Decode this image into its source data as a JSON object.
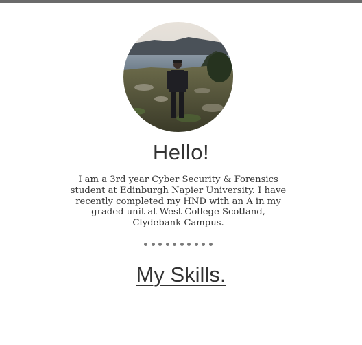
{
  "header": {
    "bar_color": "#6b6b6b"
  },
  "profile": {
    "photo_icon": "profile-photo",
    "greeting": "Hello!",
    "bio": "I am a 3rd year Cyber Security & Forensics student at Edinburgh Napier University. I have recently completed my HND with an A in my graded unit at West College Scotland, Clydebank Campus."
  },
  "divider": {
    "dot_count": 10,
    "dot_color": "#7a7a7a"
  },
  "skills": {
    "heading": "My Skills."
  }
}
